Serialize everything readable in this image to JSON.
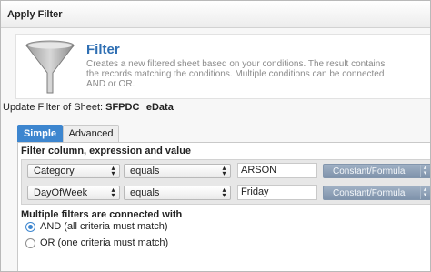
{
  "window": {
    "title": "Apply Filter"
  },
  "header": {
    "title": "Filter",
    "description_lines": [
      "Creates a new filtered sheet based on your conditions. The result contains",
      "the records matching the conditions. Multiple conditions can be connected",
      "AND or OR."
    ],
    "icon": "funnel-icon"
  },
  "sheet": {
    "prefix": "Update Filter of Sheet:",
    "name": "SFPDC   eData"
  },
  "tabs": [
    {
      "label": "Simple",
      "active": true
    },
    {
      "label": "Advanced",
      "active": false
    }
  ],
  "conditions": {
    "heading": "Filter column, expression and value",
    "rows": [
      {
        "column": "Category",
        "operator": "equals",
        "value": "ARSON",
        "value_type": "Constant/Formula"
      },
      {
        "column": "DayOfWeek",
        "operator": "equals",
        "value": "Friday",
        "value_type": "Constant/Formula"
      }
    ]
  },
  "connector": {
    "heading": "Multiple filters are connected with",
    "options": [
      {
        "label": "AND (all criteria must match)",
        "checked": true
      },
      {
        "label": "OR (one criteria must match)",
        "checked": false
      }
    ]
  },
  "colors": {
    "accent": "#3d86cf",
    "header_title": "#2f6fb3",
    "type_button": "#8fa2b9"
  }
}
